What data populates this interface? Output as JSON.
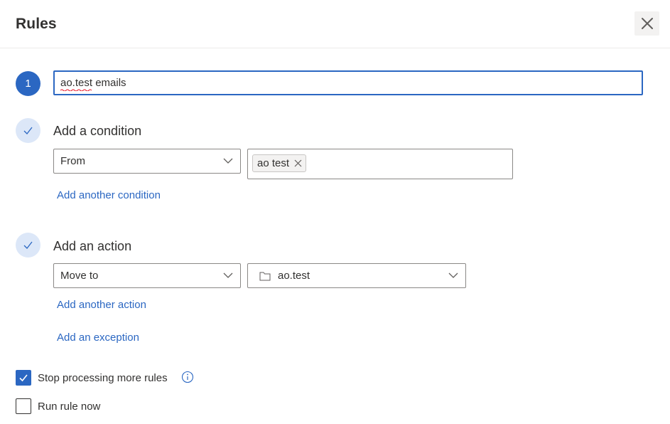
{
  "dialog": {
    "title": "Rules",
    "close_icon": "close-icon"
  },
  "step1": {
    "number": "1",
    "rule_name": "ao.test emails"
  },
  "condition": {
    "heading": "Add a condition",
    "field": "From",
    "token": "ao test",
    "add_link": "Add another condition"
  },
  "action": {
    "heading": "Add an action",
    "type": "Move to",
    "folder": "ao.test",
    "folder_icon": "folder-icon",
    "add_link": "Add another action",
    "exception_link": "Add an exception"
  },
  "options": {
    "stop_processing": {
      "label": "Stop processing more rules",
      "checked": true
    },
    "run_now": {
      "label": "Run rule now",
      "checked": false
    }
  },
  "colors": {
    "accent": "#2b67c2",
    "step_done_bg": "#dce7f8",
    "text": "#323130",
    "border": "#8a8886"
  }
}
